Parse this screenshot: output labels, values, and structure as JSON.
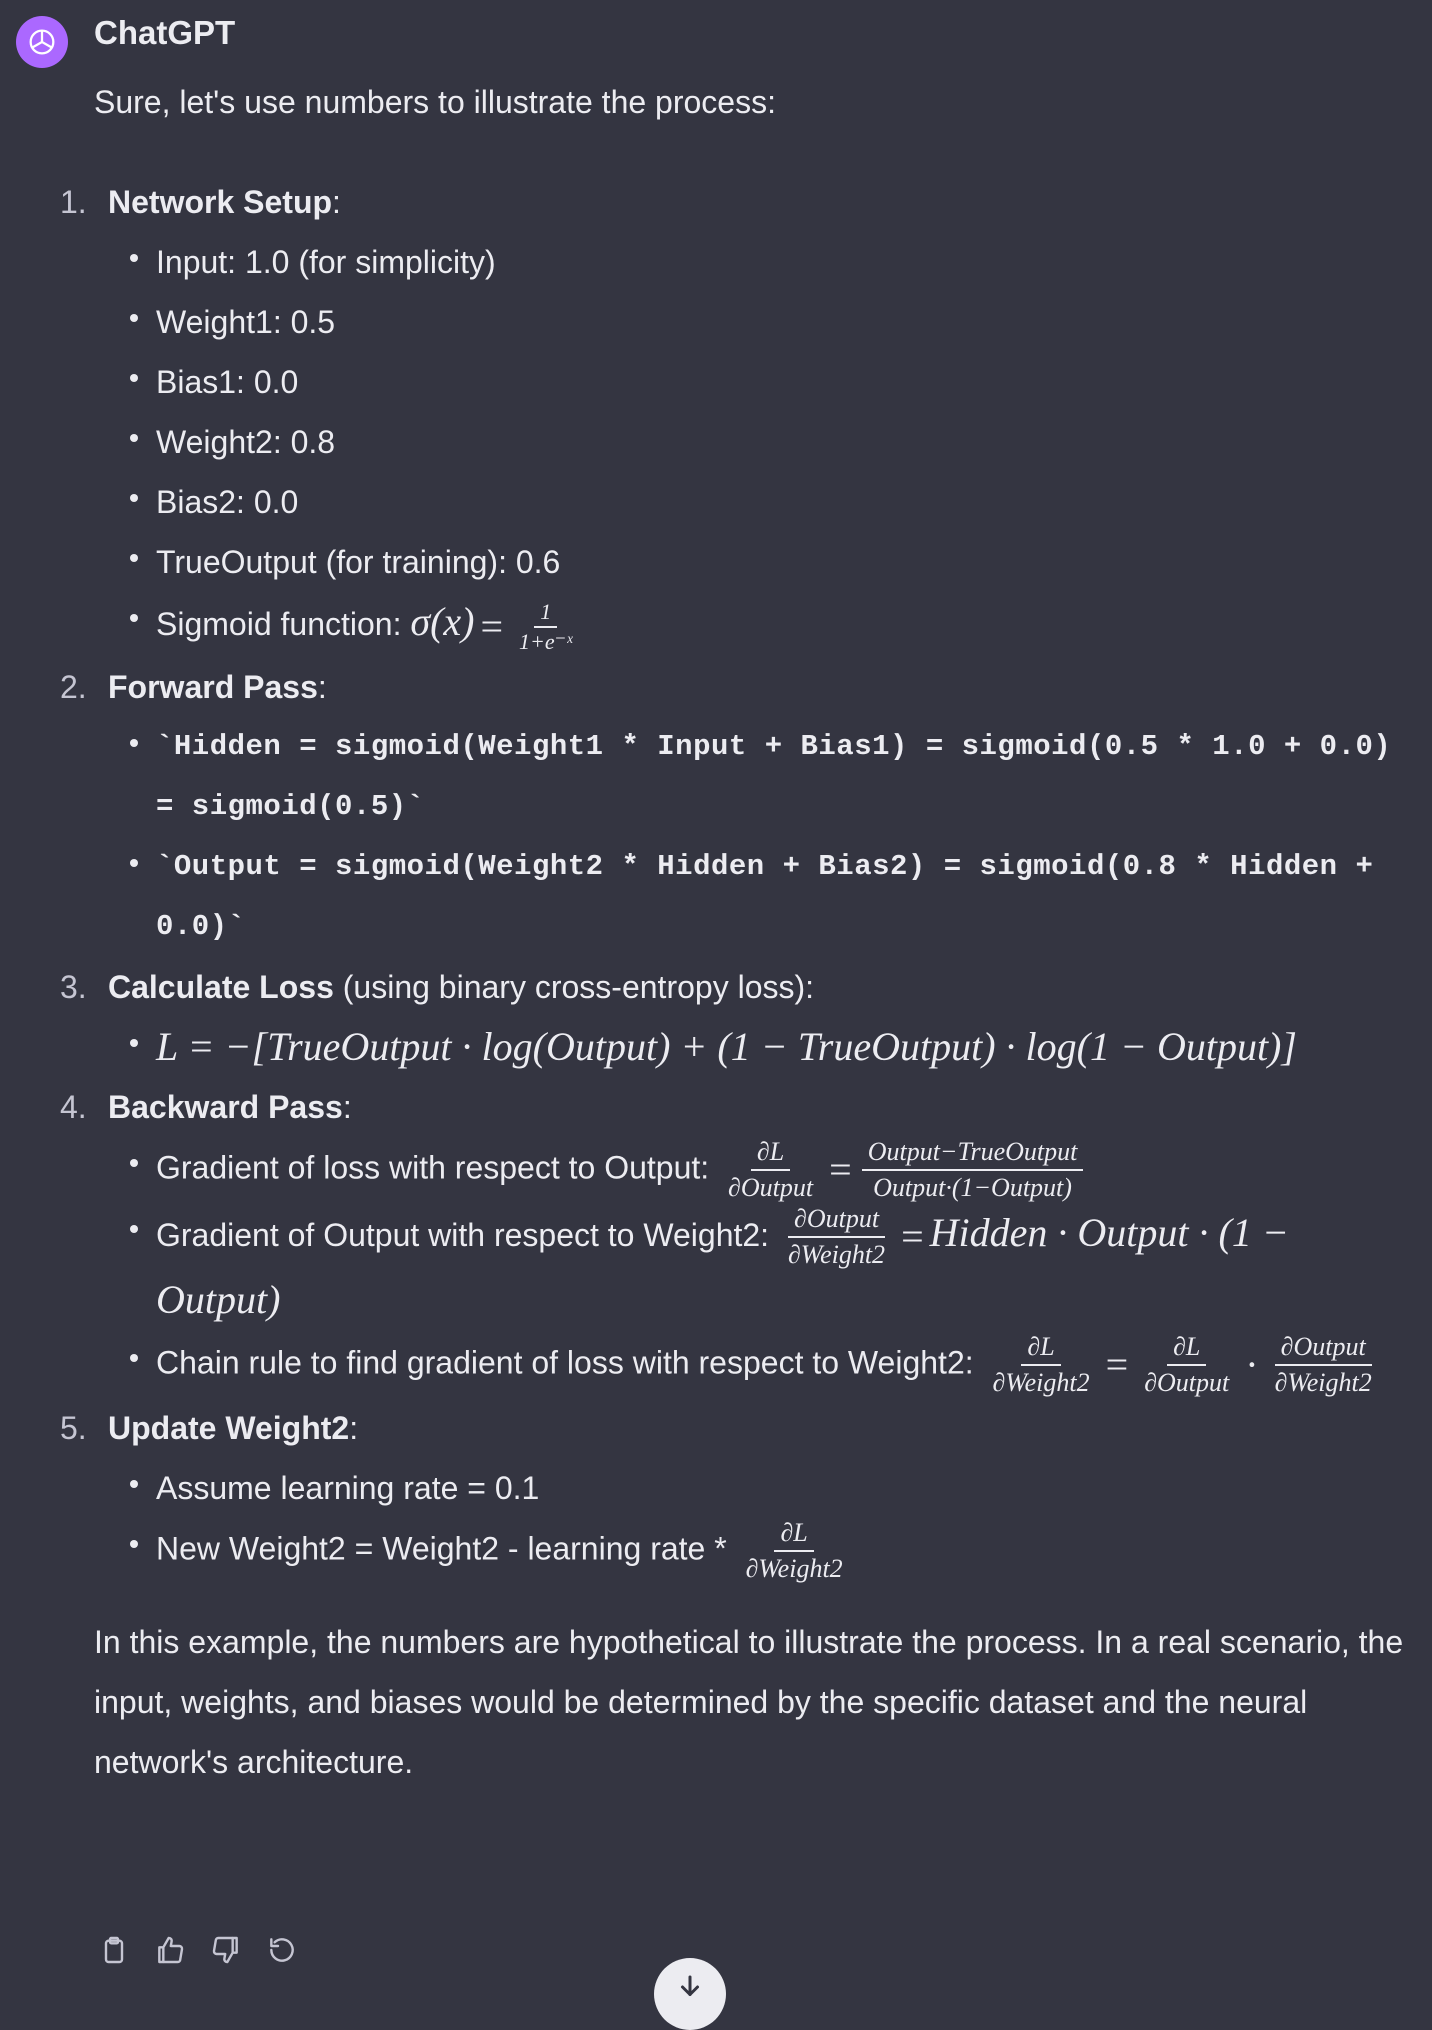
{
  "message": {
    "author": "ChatGPT",
    "avatar_icon": "openai-logo-icon",
    "avatar_color": "#ab68ff",
    "intro": "Sure, let's use numbers to illustrate the process:",
    "steps": [
      {
        "number": "1.",
        "title": "Network Setup",
        "suffix": ":",
        "bullets": [
          "Input: 1.0 (for simplicity)",
          "Weight1: 0.5",
          "Bias1: 0.0",
          "Weight2: 0.8",
          "Bias2: 0.0",
          "TrueOutput (for training): 0.6"
        ],
        "sigmoid_label": "Sigmoid function: ",
        "sigmoid_lhs": "σ(x)",
        "sigmoid_eq": "=",
        "sigmoid_num": "1",
        "sigmoid_den": "1+e⁻ˣ"
      },
      {
        "number": "2.",
        "title": "Forward Pass",
        "suffix": ":",
        "code_1": "`Hidden = sigmoid(Weight1 * Input + Bias1) = sigmoid(0.5 * 1.0 + 0.0) = sigmoid(0.5)`",
        "code_2": "`Output = sigmoid(Weight2 * Hidden + Bias2) = sigmoid(0.8 * Hidden + 0.0)`"
      },
      {
        "number": "3.",
        "title": "Calculate Loss",
        "suffix": " (using binary cross-entropy loss):",
        "loss_formula": "L = −[TrueOutput · log(Output) + (1 − TrueOutput) · log(1 − Output)]"
      },
      {
        "number": "4.",
        "title": "Backward Pass",
        "suffix": ":",
        "grad_output_label": "Gradient of loss with respect to Output: ",
        "grad_output_num": "∂L",
        "grad_output_den": "∂Output",
        "grad_output_rhs_num": "Output−TrueOutput",
        "grad_output_rhs_den": "Output·(1−Output)",
        "grad_weight_label": "Gradient of Output with respect to Weight2: ",
        "grad_weight_num": "∂Output",
        "grad_weight_den": "∂Weight2",
        "grad_weight_rhs": "Hidden · Output · (1 − Output)",
        "chain_label": "Chain rule to find gradient of loss with respect to Weight2: ",
        "chain_lhs_num": "∂L",
        "chain_lhs_den": "∂Weight2",
        "chain_r1_num": "∂L",
        "chain_r1_den": "∂Output",
        "chain_dot": "·",
        "chain_r2_num": "∂Output",
        "chain_r2_den": "∂Weight2"
      },
      {
        "number": "5.",
        "title": "Update Weight2",
        "suffix": ":",
        "lr_text": "Assume learning rate = 0.1",
        "update_text": "New Weight2 = Weight2 - learning rate * ",
        "update_num": "∂L",
        "update_den": "∂Weight2"
      }
    ],
    "outro": "In this example, the numbers are hypothetical to illustrate the process. In a real scenario, the input, weights, and biases would be determined by the specific dataset and the neural network's architecture."
  },
  "actions": {
    "icons": [
      "clipboard-icon",
      "thumbs-up-icon",
      "thumbs-down-icon",
      "regenerate-icon"
    ]
  },
  "scroll_button": {
    "icon": "arrow-down-icon"
  },
  "colors": {
    "background": "#343541",
    "text": "#ececf1"
  }
}
